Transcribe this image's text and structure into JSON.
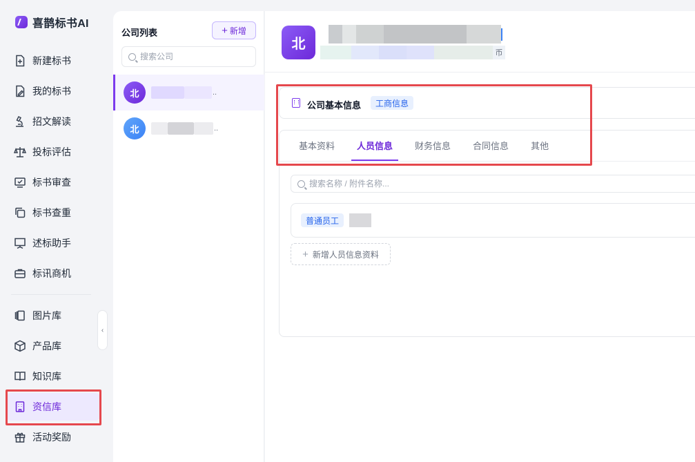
{
  "brand": {
    "name": "喜鹊标书AI"
  },
  "sidebar": {
    "items": [
      {
        "label": "新建标书",
        "icon": "file-plus-icon"
      },
      {
        "label": "我的标书",
        "icon": "file-edit-icon"
      },
      {
        "label": "招文解读",
        "icon": "microscope-icon"
      },
      {
        "label": "投标评估",
        "icon": "scale-icon"
      },
      {
        "label": "标书审查",
        "icon": "monitor-check-icon"
      },
      {
        "label": "标书查重",
        "icon": "copy-icon"
      },
      {
        "label": "述标助手",
        "icon": "presentation-icon"
      },
      {
        "label": "标讯商机",
        "icon": "briefcase-icon"
      },
      {
        "label": "图片库",
        "icon": "gallery-icon"
      },
      {
        "label": "产品库",
        "icon": "box-icon"
      },
      {
        "label": "知识库",
        "icon": "book-icon"
      },
      {
        "label": "资信库",
        "icon": "building-icon"
      },
      {
        "label": "活动奖励",
        "icon": "gift-icon"
      }
    ],
    "active_index": 11,
    "collapse_glyph": "‹"
  },
  "company_panel": {
    "title": "公司列表",
    "add_label": "新增",
    "add_glyph": "+",
    "search_placeholder": "搜索公司",
    "companies": [
      {
        "initial": "北",
        "name_suffix": "..",
        "color": "#7c3aed"
      },
      {
        "initial": "北",
        "name_suffix": "..",
        "color": "#3b82f6"
      }
    ]
  },
  "company_header": {
    "initial": "北",
    "currency_fragment": "币"
  },
  "basic_info_card": {
    "title": "公司基本信息",
    "tag": "工商信息"
  },
  "tabs": [
    "基本资料",
    "人员信息",
    "财务信息",
    "合同信息",
    "其他"
  ],
  "active_tab": 1,
  "personnel": {
    "search_placeholder": "搜索名称 / 附件名称...",
    "rows": [
      {
        "tag": "普通员工"
      }
    ],
    "add_label": "新增人员信息资料",
    "add_glyph": "+"
  },
  "colors": {
    "accent": "#7c3aed",
    "highlight": "#e5484d",
    "tag_blue": "#2563eb"
  }
}
